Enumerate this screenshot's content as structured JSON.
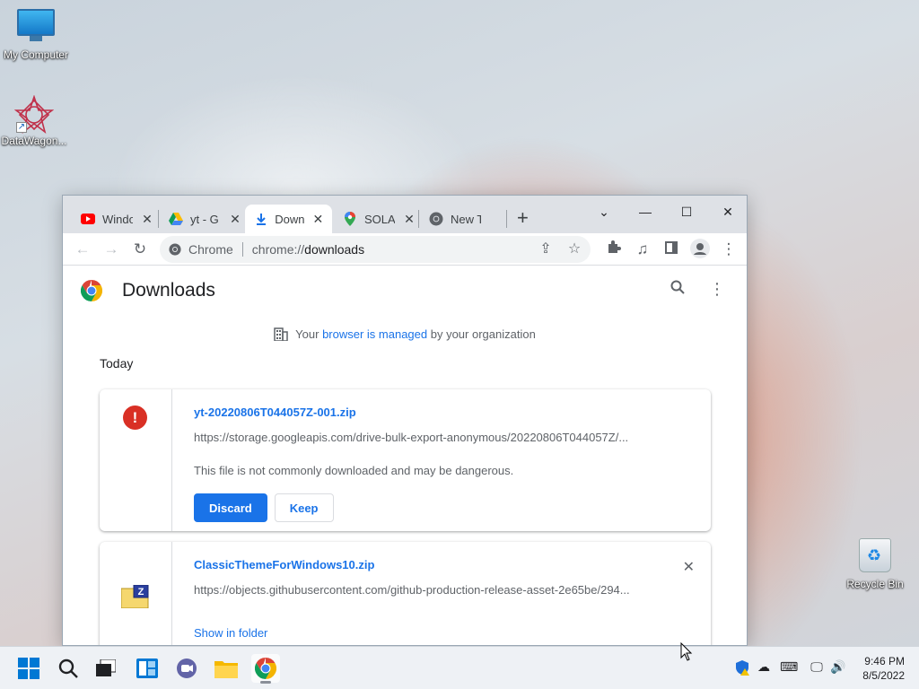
{
  "desktop": {
    "icons": [
      {
        "label": "My Computer"
      },
      {
        "label": "DataWagon..."
      },
      {
        "label": "Recycle Bin"
      }
    ]
  },
  "browser": {
    "tabs": [
      {
        "title": "Windo",
        "icon": "youtube-icon",
        "active": false
      },
      {
        "title": "yt - G",
        "icon": "google-drive-icon",
        "active": false
      },
      {
        "title": "Down",
        "icon": "download-icon",
        "active": true
      },
      {
        "title": "SOLA",
        "icon": "google-maps-icon",
        "active": false
      },
      {
        "title": "New T",
        "icon": "chrome-icon",
        "active": false
      }
    ],
    "omnibox": {
      "chip_label": "Chrome",
      "url_scheme": "chrome://",
      "url_path": "downloads"
    }
  },
  "downloads_page": {
    "title": "Downloads",
    "managed": {
      "prefix": "Your ",
      "link": "browser is managed",
      "suffix": " by your organization"
    },
    "section_label": "Today",
    "items": [
      {
        "filename": "yt-20220806T044057Z-001.zip",
        "url": "https://storage.googleapis.com/drive-bulk-export-anonymous/20220806T044057Z/...",
        "warning": "This file is not commonly downloaded and may be dangerous.",
        "discard_label": "Discard",
        "keep_label": "Keep"
      },
      {
        "filename": "ClassicThemeForWindows10.zip",
        "url": "https://objects.githubusercontent.com/github-production-release-asset-2e65be/294...",
        "action_label": "Show in folder"
      }
    ]
  },
  "taskbar": {
    "time": "9:46 PM",
    "date": "8/5/2022"
  },
  "colors": {
    "accent": "#1a73e8",
    "danger": "#d93025",
    "tabstrip": "#dee1e6"
  }
}
